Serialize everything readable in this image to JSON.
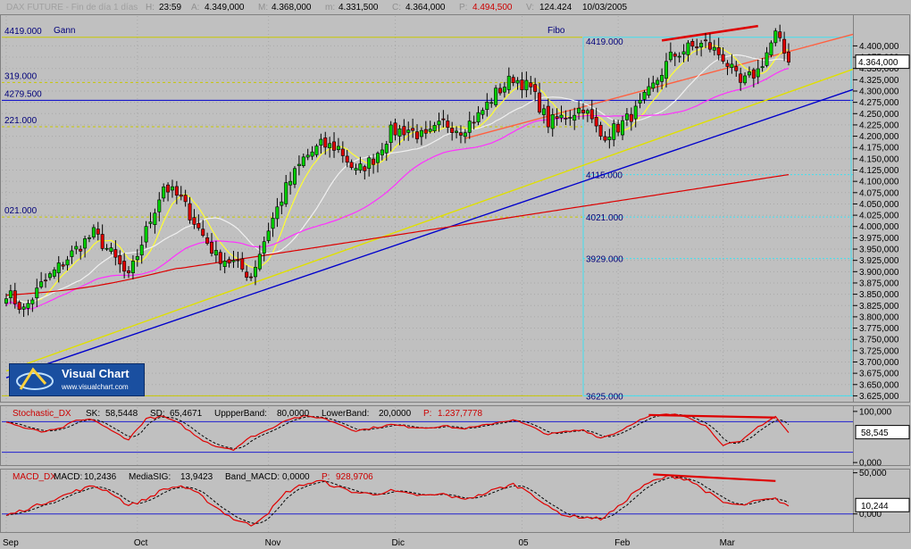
{
  "header": {
    "title": "DAX FUTURE - Fin de día 1 días",
    "fields": [
      {
        "k": "H:",
        "v": "23:59"
      },
      {
        "k": "A:",
        "v": "4.349,000"
      },
      {
        "k": "M:",
        "v": "4.368,000"
      },
      {
        "k": "m:",
        "v": "4.331,500"
      },
      {
        "k": "C:",
        "v": "4.364,000"
      },
      {
        "k": "P:",
        "v": "4.494,500",
        "color": "#cc0000"
      },
      {
        "k": "V:",
        "v": "124.424"
      },
      {
        "k": "",
        "v": "10/03/2005"
      }
    ]
  },
  "window_controls": [
    "_",
    "□",
    "×"
  ],
  "logo": {
    "title": "Visual Chart",
    "url": "www.visualchart.com"
  },
  "chart_data": [
    {
      "type": "candlestick",
      "panel": "price",
      "ylim": [
        3612,
        4470
      ],
      "yticks": [
        "4.400,000",
        "4.375,000",
        "4.350,000",
        "4.325,000",
        "4.300,000",
        "4.275,000",
        "4.250,000",
        "4.225,000",
        "4.200,000",
        "4.175,000",
        "4.150,000",
        "4.125,000",
        "4.100,000",
        "4.075,000",
        "4.050,000",
        "4.025,000",
        "4.000,000",
        "3.975,000",
        "3.950,000",
        "3.925,000",
        "3.900,000",
        "3.875,000",
        "3.850,000",
        "3.825,000",
        "3.800,000",
        "3.775,000",
        "3.750,000",
        "3.725,000",
        "3.700,000",
        "3.675,000",
        "3.650,000",
        "3.625,000"
      ],
      "x_labels": [
        "Sep",
        "Oct",
        "Nov",
        "Dic",
        "05",
        "Feb",
        "Mar"
      ],
      "x_label_bars": [
        0,
        30,
        60,
        89,
        118,
        140,
        164
      ],
      "close_waypoints": [
        [
          0,
          3855
        ],
        [
          4,
          3815
        ],
        [
          8,
          3870
        ],
        [
          12,
          3910
        ],
        [
          16,
          3950
        ],
        [
          20,
          3985
        ],
        [
          24,
          3940
        ],
        [
          28,
          3885
        ],
        [
          32,
          3990
        ],
        [
          36,
          4090
        ],
        [
          40,
          4060
        ],
        [
          44,
          3995
        ],
        [
          48,
          3935
        ],
        [
          52,
          3920
        ],
        [
          56,
          3890
        ],
        [
          60,
          3995
        ],
        [
          64,
          4085
        ],
        [
          68,
          4150
        ],
        [
          72,
          4180
        ],
        [
          76,
          4175
        ],
        [
          80,
          4120
        ],
        [
          84,
          4150
        ],
        [
          88,
          4210
        ],
        [
          92,
          4215
        ],
        [
          96,
          4195
        ],
        [
          100,
          4230
        ],
        [
          104,
          4215
        ],
        [
          108,
          4245
        ],
        [
          112,
          4295
        ],
        [
          116,
          4330
        ],
        [
          120,
          4305
        ],
        [
          124,
          4230
        ],
        [
          128,
          4245
        ],
        [
          132,
          4265
        ],
        [
          136,
          4200
        ],
        [
          140,
          4220
        ],
        [
          144,
          4255
        ],
        [
          148,
          4310
        ],
        [
          152,
          4375
        ],
        [
          156,
          4395
        ],
        [
          160,
          4405
        ],
        [
          164,
          4375
        ],
        [
          168,
          4315
        ],
        [
          172,
          4345
        ],
        [
          176,
          4425
        ],
        [
          179,
          4364
        ]
      ],
      "last_price": "4.364,000",
      "moving_averages": [
        {
          "name": "MA short",
          "color": "#ffff30",
          "period": 7
        },
        {
          "name": "MA mid",
          "color": "#f0f0f0",
          "period": 18
        },
        {
          "name": "MA long",
          "color": "#ff30ff",
          "period": 35
        },
        {
          "name": "MA 200",
          "color": "#dd0000",
          "period": 200
        }
      ],
      "gann_label": "Gann",
      "fibo_label": "Fibo",
      "gann_levels": [
        {
          "label": "4419.000",
          "value": 4419,
          "color": "#c8c800",
          "style": "solid"
        },
        {
          "label": "319.000",
          "value": 4319,
          "color": "#c8c800",
          "style": "dashed"
        },
        {
          "label": "4279.500",
          "value": 4279.5,
          "color": "#0000cc",
          "style": "solid"
        },
        {
          "label": "221.000",
          "value": 4221,
          "color": "#c8c800",
          "style": "dashed"
        },
        {
          "label": "021.000",
          "value": 4021,
          "color": "#c8c800",
          "style": "dashed"
        }
      ],
      "fibo_levels": [
        {
          "label": "4419.000",
          "value": 4419
        },
        {
          "label": "4115.000",
          "value": 4115
        },
        {
          "label": "4021.000",
          "value": 4021
        },
        {
          "label": "3929.000",
          "value": 3929
        },
        {
          "label": "3625.000",
          "value": 3625
        }
      ],
      "trendlines": [
        {
          "color": "#0000cc",
          "from": [
            0,
            3665
          ],
          "to": [
            200,
            4324
          ]
        },
        {
          "color": "#e0e000",
          "from": [
            0,
            3680
          ],
          "to": [
            200,
            4370
          ]
        },
        {
          "color": "#ff6040",
          "from": [
            105,
            4195
          ],
          "to": [
            200,
            4442
          ]
        },
        {
          "color": "#dd0000",
          "from": [
            150,
            4412
          ],
          "to": [
            172,
            4444
          ]
        }
      ]
    },
    {
      "type": "line",
      "panel": "stochastic",
      "title_fields": [
        {
          "k": "Stochastic_DX",
          "v": "",
          "color": "#cc0000"
        },
        {
          "k": "SK:",
          "v": "58,5448"
        },
        {
          "k": "SD:",
          "v": "65,4671"
        },
        {
          "k": "UppperBand:",
          "v": "80,0000"
        },
        {
          "k": "LowerBand:",
          "v": "20,0000"
        },
        {
          "k": "P:",
          "v": "1.237,7778",
          "color": "#cc0000"
        }
      ],
      "ylim": [
        -5,
        112
      ],
      "yticks": [
        "100,000",
        "0,000"
      ],
      "bands": [
        80,
        20
      ],
      "last_value": "58,545",
      "waypoints": [
        [
          0,
          80
        ],
        [
          4,
          68
        ],
        [
          8,
          60
        ],
        [
          12,
          65
        ],
        [
          16,
          82
        ],
        [
          20,
          84
        ],
        [
          24,
          62
        ],
        [
          28,
          45
        ],
        [
          32,
          86
        ],
        [
          36,
          90
        ],
        [
          40,
          74
        ],
        [
          44,
          48
        ],
        [
          48,
          32
        ],
        [
          52,
          26
        ],
        [
          56,
          50
        ],
        [
          60,
          64
        ],
        [
          64,
          84
        ],
        [
          68,
          90
        ],
        [
          72,
          88
        ],
        [
          76,
          76
        ],
        [
          80,
          62
        ],
        [
          84,
          68
        ],
        [
          88,
          74
        ],
        [
          92,
          70
        ],
        [
          96,
          68
        ],
        [
          100,
          72
        ],
        [
          104,
          66
        ],
        [
          108,
          70
        ],
        [
          112,
          78
        ],
        [
          116,
          84
        ],
        [
          120,
          70
        ],
        [
          124,
          55
        ],
        [
          128,
          60
        ],
        [
          132,
          64
        ],
        [
          136,
          48
        ],
        [
          140,
          60
        ],
        [
          144,
          80
        ],
        [
          148,
          92
        ],
        [
          152,
          94
        ],
        [
          156,
          90
        ],
        [
          160,
          72
        ],
        [
          164,
          35
        ],
        [
          168,
          40
        ],
        [
          172,
          70
        ],
        [
          176,
          90
        ],
        [
          179,
          58
        ]
      ],
      "divergence": {
        "color": "#dd0000",
        "from": [
          147,
          93
        ],
        "to": [
          176,
          88
        ]
      }
    },
    {
      "type": "line",
      "panel": "macd",
      "title_fields": [
        {
          "k": "MACD_DX",
          "v": "",
          "color": "#cc0000"
        },
        {
          "k": "MACD:",
          "v": "10,2436"
        },
        {
          "k": "MediaSIG:",
          "v": "13,9423"
        },
        {
          "k": "Band_MACD:",
          "v": "0,0000"
        },
        {
          "k": "P:",
          "v": "928,9706",
          "color": "#cc0000"
        }
      ],
      "ylim": [
        -22,
        55
      ],
      "yticks": [
        "50,000",
        "0,000"
      ],
      "last_value": "10,244",
      "waypoints": [
        [
          0,
          -2
        ],
        [
          4,
          5
        ],
        [
          8,
          12
        ],
        [
          12,
          20
        ],
        [
          16,
          28
        ],
        [
          20,
          34
        ],
        [
          24,
          26
        ],
        [
          28,
          10
        ],
        [
          32,
          18
        ],
        [
          36,
          30
        ],
        [
          40,
          34
        ],
        [
          44,
          24
        ],
        [
          48,
          8
        ],
        [
          52,
          -6
        ],
        [
          56,
          -14
        ],
        [
          60,
          2
        ],
        [
          64,
          26
        ],
        [
          68,
          36
        ],
        [
          72,
          40
        ],
        [
          76,
          32
        ],
        [
          80,
          26
        ],
        [
          84,
          24
        ],
        [
          88,
          28
        ],
        [
          92,
          24
        ],
        [
          96,
          22
        ],
        [
          100,
          24
        ],
        [
          104,
          18
        ],
        [
          108,
          22
        ],
        [
          112,
          30
        ],
        [
          116,
          36
        ],
        [
          120,
          26
        ],
        [
          124,
          8
        ],
        [
          128,
          -2
        ],
        [
          132,
          -4
        ],
        [
          136,
          -6
        ],
        [
          140,
          8
        ],
        [
          144,
          28
        ],
        [
          148,
          40
        ],
        [
          152,
          46
        ],
        [
          156,
          42
        ],
        [
          160,
          28
        ],
        [
          164,
          14
        ],
        [
          168,
          10
        ],
        [
          172,
          16
        ],
        [
          176,
          18
        ],
        [
          179,
          10
        ]
      ],
      "divergence": {
        "color": "#dd0000",
        "from": [
          148,
          48
        ],
        "to": [
          176,
          40
        ]
      }
    }
  ]
}
